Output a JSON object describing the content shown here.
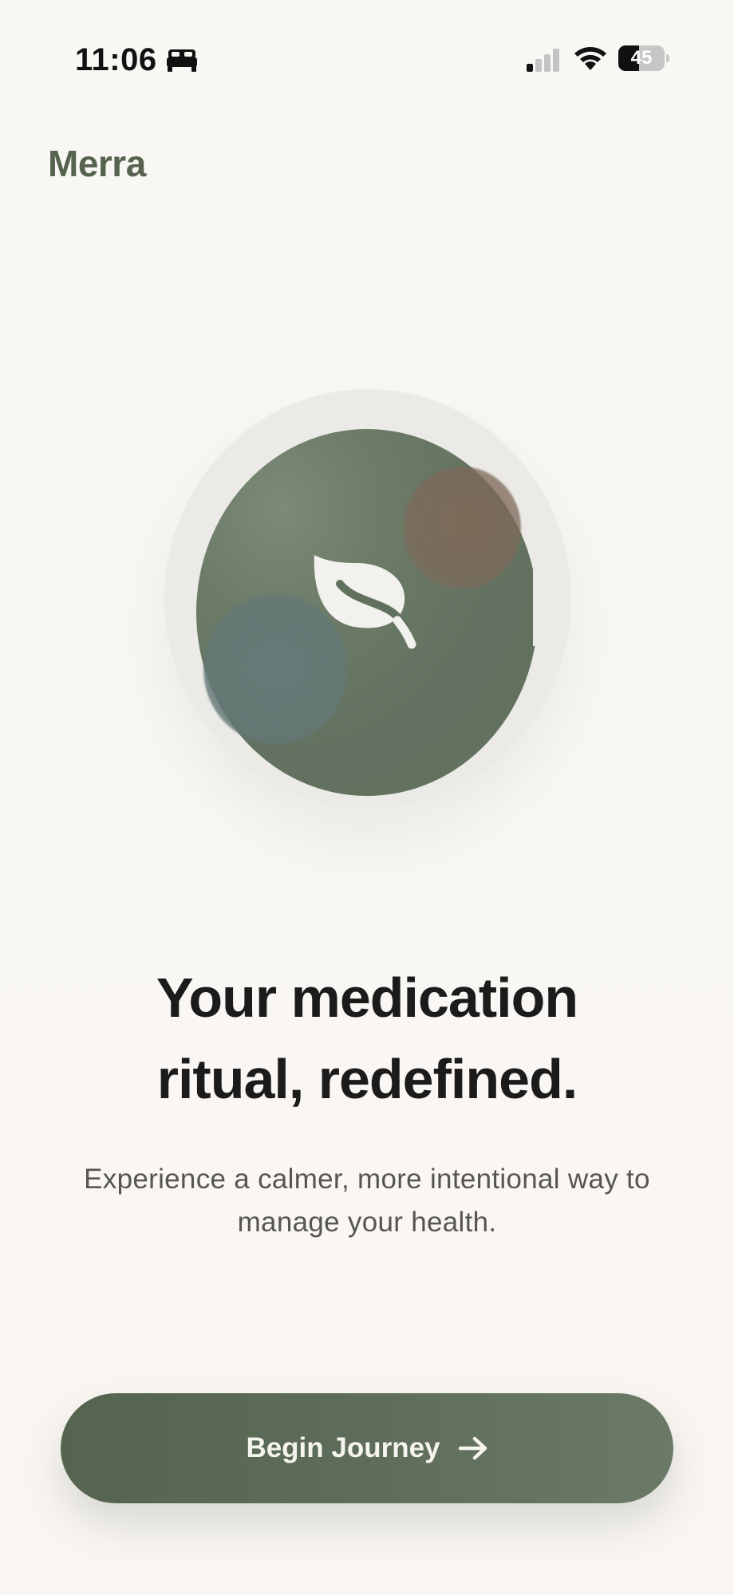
{
  "status_bar": {
    "time": "11:06",
    "battery_level": "45",
    "battery_fraction": 0.45,
    "signal_bars_active": 1,
    "signal_bars_total": 4,
    "icons": [
      "bed-icon",
      "signal-icon",
      "wifi-icon",
      "battery-icon"
    ]
  },
  "brand": {
    "name": "Merra"
  },
  "hero": {
    "icon": "leaf-icon",
    "colors": {
      "circle": "#637260",
      "rose_blob": "#826958",
      "blue_blob": "#667a78"
    }
  },
  "content": {
    "headline_line1": "Your medication",
    "headline_line2": "ritual, redefined.",
    "subtitle_line1": "Experience a calmer, more intentional way to",
    "subtitle_line2": "manage your health."
  },
  "cta": {
    "label": "Begin Journey",
    "icon": "arrow-right-icon"
  },
  "colors": {
    "accent": "#5d6c58",
    "background": "#f8f7f3",
    "text_primary": "#1b1b1b",
    "text_secondary": "#555555"
  }
}
